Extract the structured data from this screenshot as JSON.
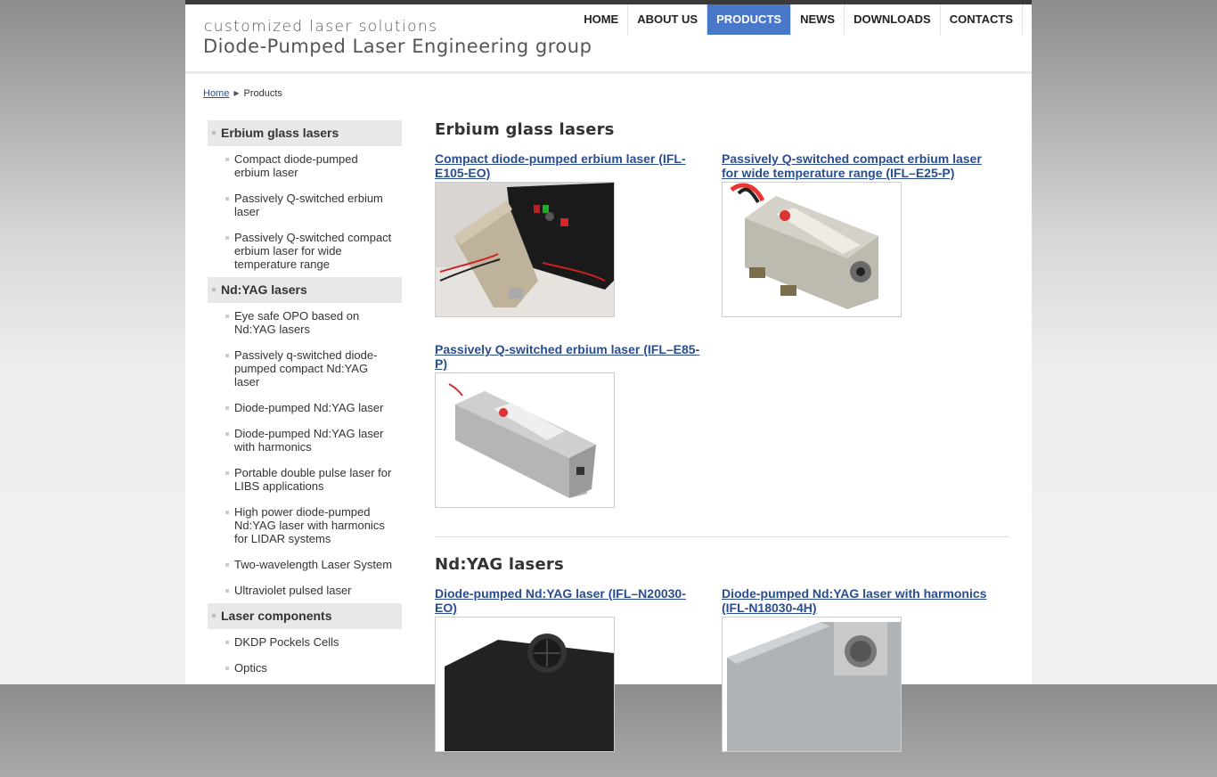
{
  "header": {
    "tagline": "customized laser solutions",
    "group_name": "Diode-Pumped Laser Engineering group"
  },
  "nav": [
    {
      "label": "HOME",
      "active": false
    },
    {
      "label": "ABOUT US",
      "active": false
    },
    {
      "label": "PRODUCTS",
      "active": true
    },
    {
      "label": "NEWS",
      "active": false
    },
    {
      "label": "DOWNLOADS",
      "active": false
    },
    {
      "label": "CONTACTS",
      "active": false
    }
  ],
  "breadcrumb": {
    "home": "Home",
    "current": "Products"
  },
  "sidebar": {
    "categories": [
      {
        "label": "Erbium glass lasers",
        "items": [
          "Compact diode-pumped erbium laser",
          "Passively Q-switched erbium laser",
          "Passively Q-switched compact erbium laser for wide temperature range"
        ]
      },
      {
        "label": "Nd:YAG lasers",
        "items": [
          "Eye safe OPO based on Nd:YAG lasers",
          "Passively q-switched diode-pumped compact Nd:YAG laser",
          "Diode-pumped Nd:YAG laser",
          "Diode-pumped Nd:YAG laser with harmonics",
          "Portable double pulse laser for LIBS applications",
          "High power diode-pumped Nd:YAG laser with harmonics for LIDAR systems",
          "Two-wavelength Laser System",
          "Ultraviolet pulsed laser"
        ]
      },
      {
        "label": "Laser components",
        "items": [
          "DKDP Pockels Cells",
          "Optics"
        ]
      }
    ]
  },
  "sections": [
    {
      "title": "Erbium glass lasers",
      "products": [
        "Compact diode-pumped erbium laser (IFL-E105-EO)",
        "Passively Q-switched compact erbium laser for wide temperature range (IFL–E25-P)",
        "Passively Q-switched erbium laser (IFL–E85-P)"
      ]
    },
    {
      "title": "Nd:YAG lasers",
      "products": [
        "Diode-pumped Nd:YAG laser (IFL–N20030-EO)",
        "Diode-pumped Nd:YAG laser with harmonics (IFL-N18030-4H)"
      ]
    }
  ],
  "colors": {
    "accent": "#4a78c8",
    "link": "#2a4d8f"
  }
}
